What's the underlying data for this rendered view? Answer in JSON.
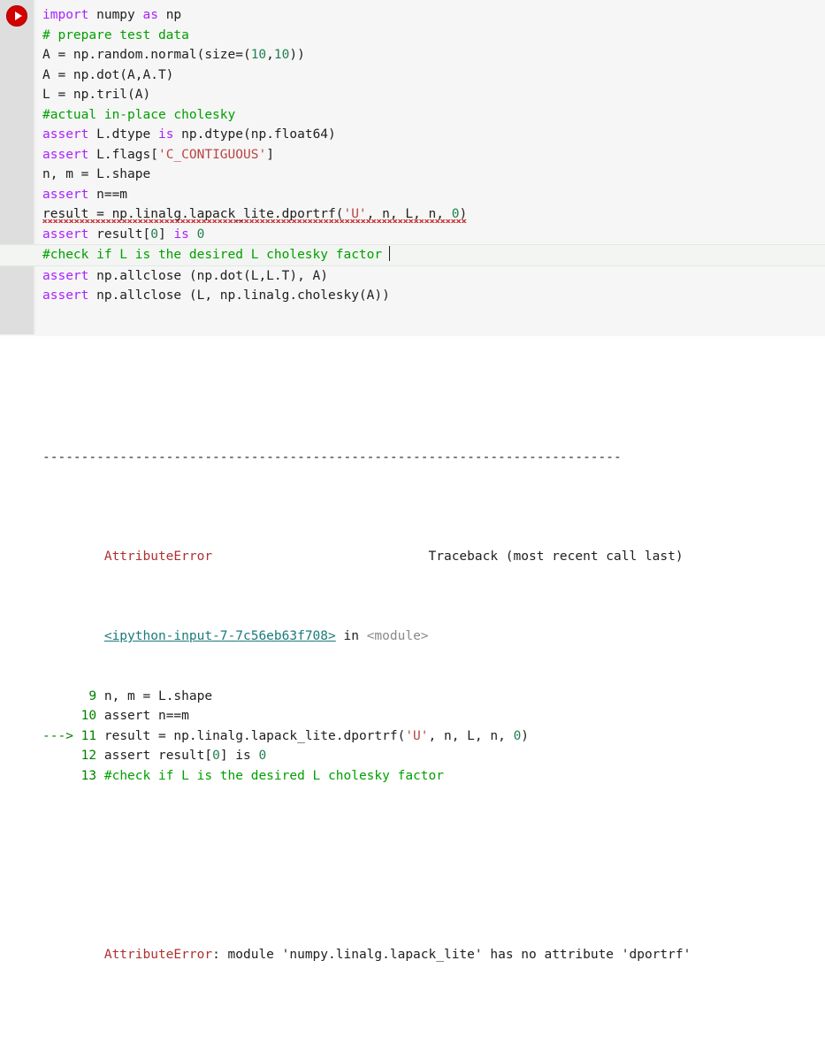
{
  "notebook": {
    "run_button_label": "run-cell",
    "icon": "play-icon"
  },
  "colors": {
    "keyword": "#aa22ff",
    "comment": "#00a000",
    "string": "#bb4444",
    "number": "#208050",
    "error": "#b03030",
    "traceback_file": "#1a7a7a",
    "run_button": "#d40000",
    "cell_background": "#f6f6f6",
    "gutter": "#dedede"
  },
  "code_cell": {
    "lines": [
      [
        {
          "t": "import",
          "c": "kw"
        },
        {
          "t": " numpy ",
          "c": "pln"
        },
        {
          "t": "as",
          "c": "kw"
        },
        {
          "t": " np",
          "c": "pln"
        }
      ],
      [
        {
          "t": "# prepare test data",
          "c": "cmt"
        }
      ],
      [
        {
          "t": "A = np.random.normal(size=(",
          "c": "pln"
        },
        {
          "t": "10",
          "c": "num"
        },
        {
          "t": ",",
          "c": "pln"
        },
        {
          "t": "10",
          "c": "num"
        },
        {
          "t": "))",
          "c": "pln"
        }
      ],
      [
        {
          "t": "A = np.dot(A,A.T)",
          "c": "pln"
        }
      ],
      [
        {
          "t": "L = np.tril(A)",
          "c": "pln"
        }
      ],
      [
        {
          "t": "#actual in-place cholesky",
          "c": "cmt"
        }
      ],
      [
        {
          "t": "assert",
          "c": "kw"
        },
        {
          "t": " L.dtype ",
          "c": "pln"
        },
        {
          "t": "is",
          "c": "kw"
        },
        {
          "t": " np.dtype(np.float64)",
          "c": "pln"
        }
      ],
      [
        {
          "t": "assert",
          "c": "kw"
        },
        {
          "t": " L.flags[",
          "c": "pln"
        },
        {
          "t": "'C_CONTIGUOUS'",
          "c": "str"
        },
        {
          "t": "]",
          "c": "pln"
        }
      ],
      [
        {
          "t": "n, m = L.shape",
          "c": "pln"
        }
      ],
      [
        {
          "t": "assert",
          "c": "kw"
        },
        {
          "t": " n==m",
          "c": "pln"
        }
      ],
      [
        {
          "t": "result = np.linalg.lapack_lite.dportrf(",
          "c": "pln",
          "sq": true
        },
        {
          "t": "'U'",
          "c": "str",
          "sq": true
        },
        {
          "t": ", n, L, n, ",
          "c": "pln",
          "sq": true
        },
        {
          "t": "0",
          "c": "num",
          "sq": true
        },
        {
          "t": ")",
          "c": "pln",
          "sq": true
        }
      ],
      [
        {
          "t": "assert",
          "c": "kw"
        },
        {
          "t": " result[",
          "c": "pln"
        },
        {
          "t": "0",
          "c": "num"
        },
        {
          "t": "] ",
          "c": "pln"
        },
        {
          "t": "is",
          "c": "kw"
        },
        {
          "t": " ",
          "c": "pln"
        },
        {
          "t": "0",
          "c": "num"
        }
      ],
      [
        {
          "t": "#check if L is the desired L cholesky factor",
          "c": "cmt",
          "caret": true
        }
      ],
      [
        {
          "t": "assert",
          "c": "kw"
        },
        {
          "t": " np.allclose (np.dot(L,L.T), A)",
          "c": "pln"
        }
      ],
      [
        {
          "t": "assert",
          "c": "kw"
        },
        {
          "t": " np.allclose (L, np.linalg.cholesky(A))",
          "c": "pln"
        }
      ]
    ],
    "active_line_index": 12,
    "squiggle_line_index": 10,
    "caret_visible": true
  },
  "output": {
    "separator": "---------------------------------------------------------------------------",
    "error_header": {
      "type": "AttributeError",
      "traceback_note": "Traceback (most recent call last)"
    },
    "frame": {
      "file": "<ipython-input-7-7c56eb63f708>",
      "in_word": "in",
      "scope": "<module>"
    },
    "source_lines": [
      {
        "arrow": "",
        "num": "9",
        "segments": [
          {
            "t": "n, m = L.shape",
            "c": "tb-plain"
          }
        ]
      },
      {
        "arrow": "",
        "num": "10",
        "segments": [
          {
            "t": "assert n==m",
            "c": "tb-plain"
          }
        ]
      },
      {
        "arrow": "--->",
        "num": "11",
        "segments": [
          {
            "t": "result = np.linalg.lapack_lite.dportrf(",
            "c": "tb-plain"
          },
          {
            "t": "'U'",
            "c": "tb-str"
          },
          {
            "t": ", n, L, n, ",
            "c": "tb-plain"
          },
          {
            "t": "0",
            "c": "num"
          },
          {
            "t": ")",
            "c": "tb-plain"
          }
        ]
      },
      {
        "arrow": "",
        "num": "12",
        "segments": [
          {
            "t": "assert result[",
            "c": "tb-plain"
          },
          {
            "t": "0",
            "c": "num"
          },
          {
            "t": "] is ",
            "c": "tb-plain"
          },
          {
            "t": "0",
            "c": "num"
          }
        ]
      },
      {
        "arrow": "",
        "num": "13",
        "segments": [
          {
            "t": "#check if L is the desired L cholesky factor",
            "c": "tb-green"
          }
        ]
      }
    ],
    "final_message": {
      "error_name": "AttributeError",
      "rest_pre": ": module ",
      "module_name": "'numpy.linalg.lapack_lite'",
      "rest_mid": " has no attribute ",
      "attribute_name": "'dportrf'"
    }
  }
}
